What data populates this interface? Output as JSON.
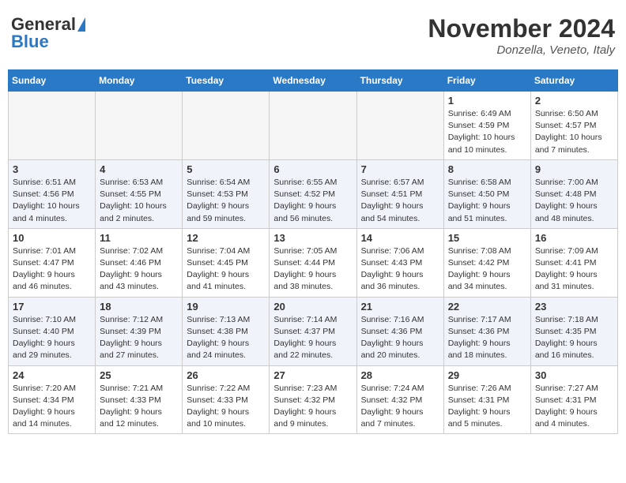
{
  "header": {
    "logo_line1": "General",
    "logo_line2": "Blue",
    "month_title": "November 2024",
    "location": "Donzella, Veneto, Italy"
  },
  "weekdays": [
    "Sunday",
    "Monday",
    "Tuesday",
    "Wednesday",
    "Thursday",
    "Friday",
    "Saturday"
  ],
  "weeks": [
    [
      {
        "day": "",
        "empty": true
      },
      {
        "day": "",
        "empty": true
      },
      {
        "day": "",
        "empty": true
      },
      {
        "day": "",
        "empty": true
      },
      {
        "day": "",
        "empty": true
      },
      {
        "day": "1",
        "sunrise": "6:49 AM",
        "sunset": "4:59 PM",
        "daylight": "10 hours and 10 minutes."
      },
      {
        "day": "2",
        "sunrise": "6:50 AM",
        "sunset": "4:57 PM",
        "daylight": "10 hours and 7 minutes."
      }
    ],
    [
      {
        "day": "3",
        "sunrise": "6:51 AM",
        "sunset": "4:56 PM",
        "daylight": "10 hours and 4 minutes."
      },
      {
        "day": "4",
        "sunrise": "6:53 AM",
        "sunset": "4:55 PM",
        "daylight": "10 hours and 2 minutes."
      },
      {
        "day": "5",
        "sunrise": "6:54 AM",
        "sunset": "4:53 PM",
        "daylight": "9 hours and 59 minutes."
      },
      {
        "day": "6",
        "sunrise": "6:55 AM",
        "sunset": "4:52 PM",
        "daylight": "9 hours and 56 minutes."
      },
      {
        "day": "7",
        "sunrise": "6:57 AM",
        "sunset": "4:51 PM",
        "daylight": "9 hours and 54 minutes."
      },
      {
        "day": "8",
        "sunrise": "6:58 AM",
        "sunset": "4:50 PM",
        "daylight": "9 hours and 51 minutes."
      },
      {
        "day": "9",
        "sunrise": "7:00 AM",
        "sunset": "4:48 PM",
        "daylight": "9 hours and 48 minutes."
      }
    ],
    [
      {
        "day": "10",
        "sunrise": "7:01 AM",
        "sunset": "4:47 PM",
        "daylight": "9 hours and 46 minutes."
      },
      {
        "day": "11",
        "sunrise": "7:02 AM",
        "sunset": "4:46 PM",
        "daylight": "9 hours and 43 minutes."
      },
      {
        "day": "12",
        "sunrise": "7:04 AM",
        "sunset": "4:45 PM",
        "daylight": "9 hours and 41 minutes."
      },
      {
        "day": "13",
        "sunrise": "7:05 AM",
        "sunset": "4:44 PM",
        "daylight": "9 hours and 38 minutes."
      },
      {
        "day": "14",
        "sunrise": "7:06 AM",
        "sunset": "4:43 PM",
        "daylight": "9 hours and 36 minutes."
      },
      {
        "day": "15",
        "sunrise": "7:08 AM",
        "sunset": "4:42 PM",
        "daylight": "9 hours and 34 minutes."
      },
      {
        "day": "16",
        "sunrise": "7:09 AM",
        "sunset": "4:41 PM",
        "daylight": "9 hours and 31 minutes."
      }
    ],
    [
      {
        "day": "17",
        "sunrise": "7:10 AM",
        "sunset": "4:40 PM",
        "daylight": "9 hours and 29 minutes."
      },
      {
        "day": "18",
        "sunrise": "7:12 AM",
        "sunset": "4:39 PM",
        "daylight": "9 hours and 27 minutes."
      },
      {
        "day": "19",
        "sunrise": "7:13 AM",
        "sunset": "4:38 PM",
        "daylight": "9 hours and 24 minutes."
      },
      {
        "day": "20",
        "sunrise": "7:14 AM",
        "sunset": "4:37 PM",
        "daylight": "9 hours and 22 minutes."
      },
      {
        "day": "21",
        "sunrise": "7:16 AM",
        "sunset": "4:36 PM",
        "daylight": "9 hours and 20 minutes."
      },
      {
        "day": "22",
        "sunrise": "7:17 AM",
        "sunset": "4:36 PM",
        "daylight": "9 hours and 18 minutes."
      },
      {
        "day": "23",
        "sunrise": "7:18 AM",
        "sunset": "4:35 PM",
        "daylight": "9 hours and 16 minutes."
      }
    ],
    [
      {
        "day": "24",
        "sunrise": "7:20 AM",
        "sunset": "4:34 PM",
        "daylight": "9 hours and 14 minutes."
      },
      {
        "day": "25",
        "sunrise": "7:21 AM",
        "sunset": "4:33 PM",
        "daylight": "9 hours and 12 minutes."
      },
      {
        "day": "26",
        "sunrise": "7:22 AM",
        "sunset": "4:33 PM",
        "daylight": "9 hours and 10 minutes."
      },
      {
        "day": "27",
        "sunrise": "7:23 AM",
        "sunset": "4:32 PM",
        "daylight": "9 hours and 9 minutes."
      },
      {
        "day": "28",
        "sunrise": "7:24 AM",
        "sunset": "4:32 PM",
        "daylight": "9 hours and 7 minutes."
      },
      {
        "day": "29",
        "sunrise": "7:26 AM",
        "sunset": "4:31 PM",
        "daylight": "9 hours and 5 minutes."
      },
      {
        "day": "30",
        "sunrise": "7:27 AM",
        "sunset": "4:31 PM",
        "daylight": "9 hours and 4 minutes."
      }
    ]
  ]
}
